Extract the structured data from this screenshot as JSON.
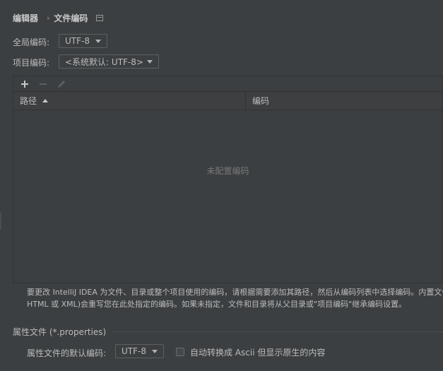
{
  "breadcrumb": {
    "parent": "编辑器",
    "separator": "›",
    "current": "文件编码",
    "icon": "window-icon"
  },
  "global_encoding": {
    "label": "全局编码:",
    "value": "UTF-8"
  },
  "project_encoding": {
    "label": "项目编码:",
    "value": "<系统默认: UTF-8>"
  },
  "toolbar": {
    "add_icon": "plus-icon",
    "remove_icon": "minus-icon",
    "edit_icon": "pencil-icon"
  },
  "table": {
    "columns": [
      "路径",
      "编码"
    ],
    "sort_column": "路径",
    "sort_direction": "ascending",
    "empty_text": "未配置编码",
    "rows": []
  },
  "description": {
    "line1": "要更改 IntelliJ IDEA 为文件、目录或整个项目使用的编码，请根据需要添加其路径，然后从编码列表中选择编码。内置文件",
    "line2": "HTML 或 XML)会重写您在此处指定的编码。如果未指定，文件和目录将从父目录或\"项目编码\"继承编码设置。"
  },
  "properties": {
    "section_title": "属性文件 (*.properties)",
    "default_encoding_label": "属性文件的默认编码:",
    "default_encoding_value": "UTF-8",
    "native_to_ascii_label": "自动转换成 Ascii 但显示原生的内容",
    "native_to_ascii_checked": false
  },
  "colors": {
    "background": "#3c3f41",
    "text": "#bbbbbb",
    "border": "#323232",
    "muted_text": "#787878"
  }
}
